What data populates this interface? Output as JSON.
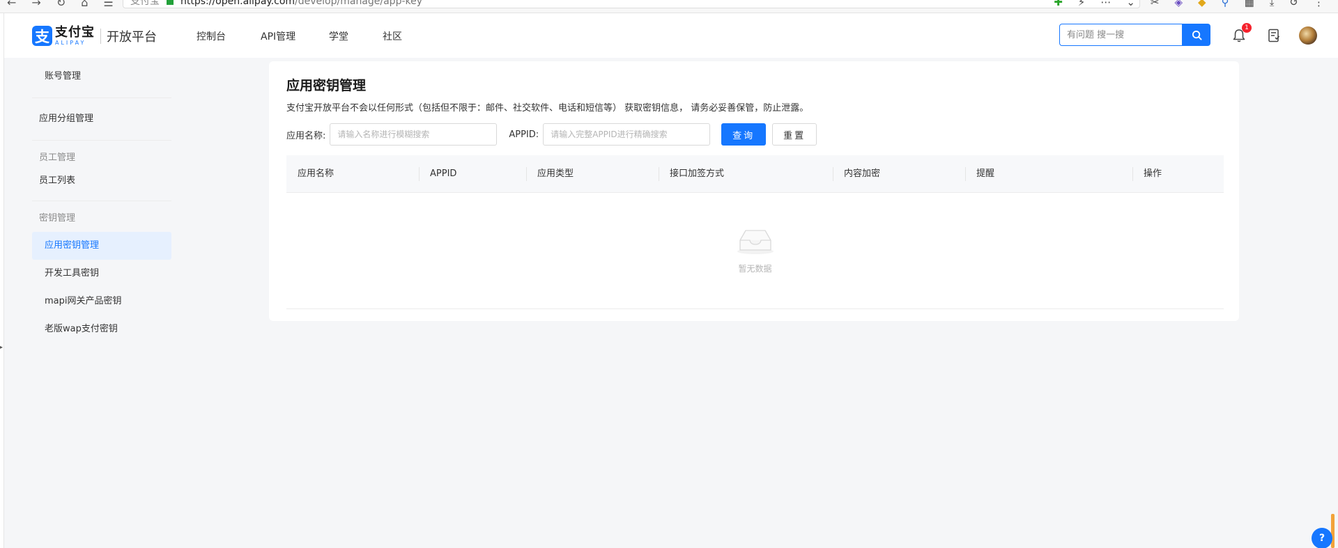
{
  "browser": {
    "nav_glyphs": [
      "←",
      "→",
      "↻",
      "⌂",
      "☰"
    ],
    "site_name": "支付宝",
    "url_domain": "https://open.alipay.com",
    "url_path": "/develop/manage/app-key",
    "tool_glyphs": [
      "✚",
      "⚡",
      "⋯",
      "⌄",
      "✂",
      "◈",
      "◆",
      "⚲",
      "▦",
      "⤓",
      "↺",
      "⋮"
    ]
  },
  "header": {
    "logo_mark": "支",
    "logo_cn": "支付宝",
    "logo_en": "ALIPAY",
    "platform": "开放平台",
    "nav": [
      "控制台",
      "API管理",
      "学堂",
      "社区"
    ],
    "search_placeholder": "有问题 搜一搜",
    "notification_count": "1"
  },
  "sidebar": {
    "account": "账号管理",
    "app_group": "应用分组管理",
    "staff_group": "员工管理",
    "staff_list": "员工列表",
    "key_group": "密钥管理",
    "items": [
      "应用密钥管理",
      "开发工具密钥",
      "mapi网关产品密钥",
      "老版wap支付密钥"
    ],
    "active_item": "应用密钥管理"
  },
  "main": {
    "title": "应用密钥管理",
    "description": "支付宝开放平台不会以任何形式（包括但不限于：邮件、社交软件、电话和短信等） 获取密钥信息， 请务必妥善保管，防止泄露。",
    "filter": {
      "name_label": "应用名称:",
      "name_placeholder": "请输入名称进行模糊搜索",
      "appid_label": "APPID:",
      "appid_placeholder": "请输入完整APPID进行精确搜索",
      "query_label": "查询",
      "reset_label": "重置"
    },
    "table": {
      "columns": [
        "应用名称",
        "APPID",
        "应用类型",
        "接口加签方式",
        "内容加密",
        "提醒",
        "操作"
      ],
      "rows": [],
      "empty_text": "暂无数据"
    }
  },
  "colors": {
    "brand": "#1677ff",
    "badge": "#f5222d",
    "active_bg": "#e6f0fe"
  }
}
